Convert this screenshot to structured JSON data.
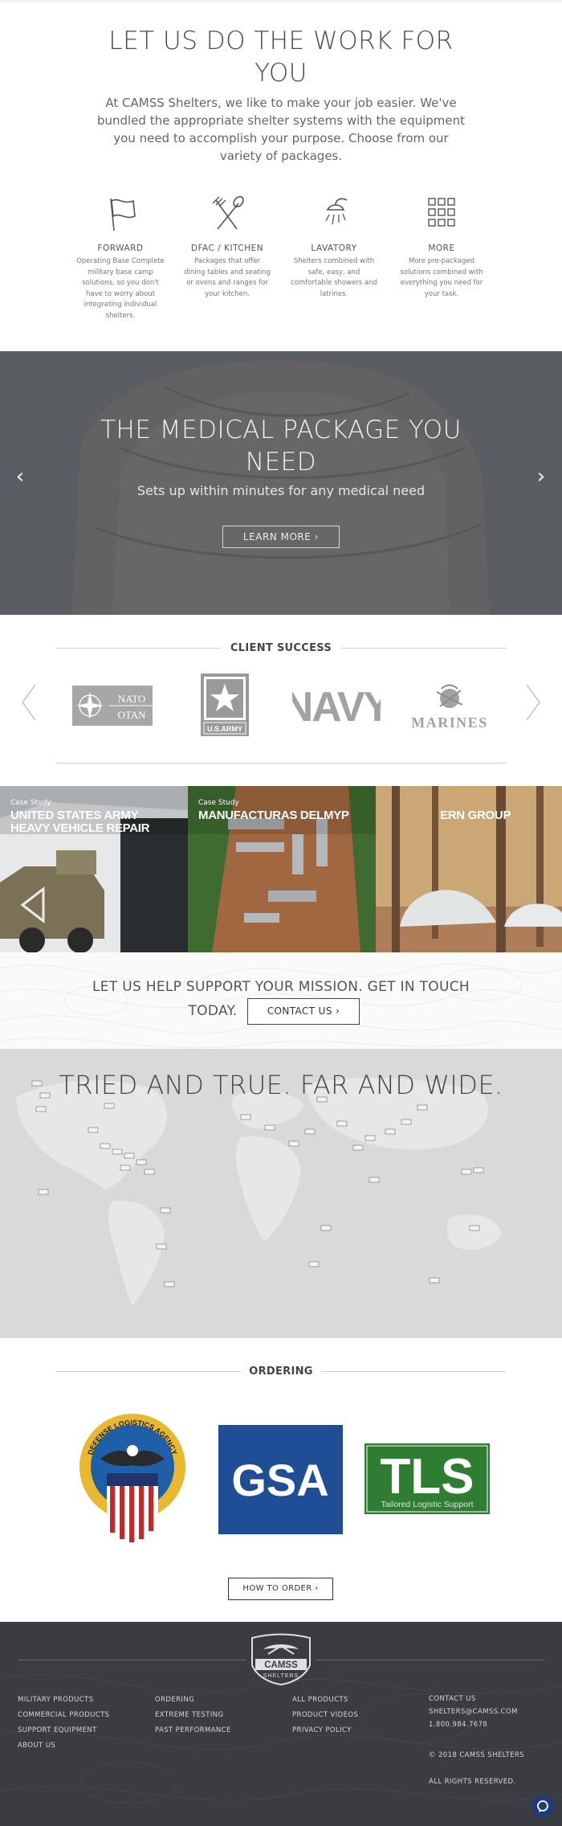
{
  "intro": {
    "title": "LET US DO THE WORK FOR YOU",
    "text": "At CAMSS Shelters, we like to make your job easier. We've bundled the appropriate shelter systems with the equipment you need to accomplish your purpose. Choose from our variety of packages.",
    "packages": [
      {
        "icon": "flag-icon",
        "name": "FORWARD",
        "desc": "Operating Base Complete military base camp solutions, so you don't have to worry about integrating individual shelters."
      },
      {
        "icon": "fork-spoon-icon",
        "name": "DFAC / KITCHEN",
        "desc": "Packages that offer dining tables and seating or ovens and ranges for your kitchen."
      },
      {
        "icon": "shower-icon",
        "name": "LAVATORY",
        "desc": "Shelters combined with safe, easy, and comfortable showers and latrines."
      },
      {
        "icon": "grid-icon",
        "name": "MORE",
        "desc": "More pre-packaged solutions combined with everything you need for your task."
      }
    ]
  },
  "hero": {
    "title": "THE MEDICAL PACKAGE YOU NEED",
    "subtitle": "Sets up within minutes for any medical need",
    "button": "LEARN MORE ›",
    "prev": "‹",
    "next": "›"
  },
  "clients": {
    "heading": "CLIENT SUCCESS",
    "logos": {
      "nato_line1": "NATO",
      "nato_line2": "OTAN",
      "army": "U.S.ARMY",
      "navy": "NAVY",
      "marines": "MARINES"
    }
  },
  "cases": [
    {
      "kicker": "Case Study",
      "title": "UNITED STATES ARMY HEAVY VEHICLE REPAIR"
    },
    {
      "kicker": "Case Study",
      "title": "MANUFACTURAS DELMYP"
    },
    {
      "kicker": "",
      "title": "ERN GROUP"
    }
  ],
  "contact": {
    "line1": "LET US HELP SUPPORT YOUR MISSION. GET IN TOUCH",
    "line2": "TODAY.",
    "button": "CONTACT US ›"
  },
  "map": {
    "title": "TRIED AND TRUE. FAR AND WIDE."
  },
  "ordering": {
    "heading": "ORDERING",
    "dla_ring_top": "DEFENSE LOGISTICS AGENCY",
    "gsa": "GSA",
    "tls": "TLS",
    "tls_sub": "Tailored Logistic Support",
    "button": "HOW TO ORDER ›"
  },
  "footer": {
    "logo": "CAMSS",
    "logo_sub": "SHELTERS",
    "col1": [
      "MILITARY PRODUCTS",
      "COMMERCIAL PRODUCTS",
      "SUPPORT EQUIPMENT",
      "ABOUT US"
    ],
    "col2": [
      "ORDERING",
      "EXTREME TESTING",
      "PAST PERFORMANCE"
    ],
    "col3": [
      "ALL PRODUCTS",
      "PRODUCT VIDEOS",
      "PRIVACY POLICY"
    ],
    "contact_label": "CONTACT US",
    "email": "SHELTERS@CAMSS.COM",
    "phone": "1.800.984.7678",
    "copyright": "© 2018 CAMSS SHELTERS",
    "rights": "ALL RIGHTS RESERVED."
  },
  "colors": {
    "hero_bg": "#5f6166",
    "footer_bg": "#3a3c42",
    "gsa_blue": "#1f4e96",
    "tls_green": "#2e7d32",
    "chat_blue": "#1d3c78"
  }
}
